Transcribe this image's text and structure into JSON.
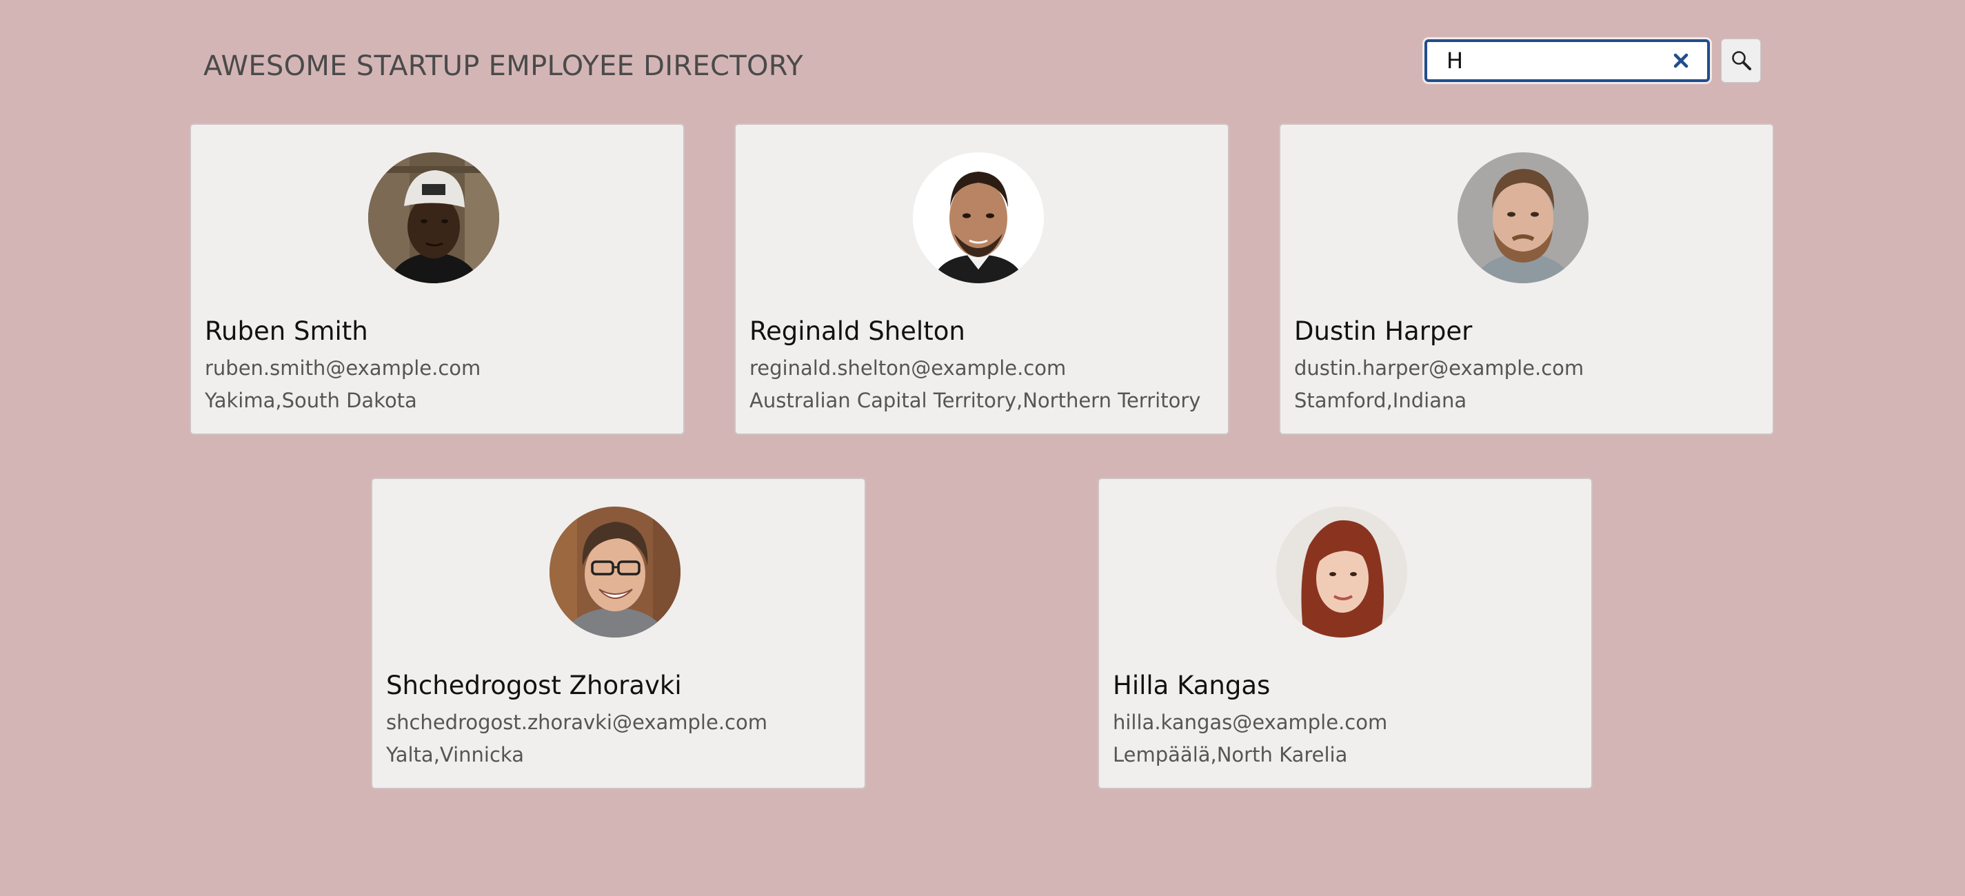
{
  "header": {
    "title": "AWESOME STARTUP EMPLOYEE DIRECTORY"
  },
  "search": {
    "value": "H",
    "clear_icon": "close-icon",
    "button_icon": "search-icon"
  },
  "colors": {
    "page_background": "#d4b5b6",
    "card_background": "#f0efee",
    "search_border": "#1f4e8c"
  },
  "employees": [
    {
      "name": "Ruben Smith",
      "email": "ruben.smith@example.com",
      "location": "Yakima,South Dakota"
    },
    {
      "name": "Reginald Shelton",
      "email": "reginald.shelton@example.com",
      "location": "Australian Capital Territory,Northern Territory"
    },
    {
      "name": "Dustin Harper",
      "email": "dustin.harper@example.com",
      "location": "Stamford,Indiana"
    },
    {
      "name": "Shchedrogost Zhoravki",
      "email": "shchedrogost.zhoravki@example.com",
      "location": "Yalta,Vinnicka"
    },
    {
      "name": "Hilla Kangas",
      "email": "hilla.kangas@example.com",
      "location": "Lempäälä,North Karelia"
    }
  ]
}
